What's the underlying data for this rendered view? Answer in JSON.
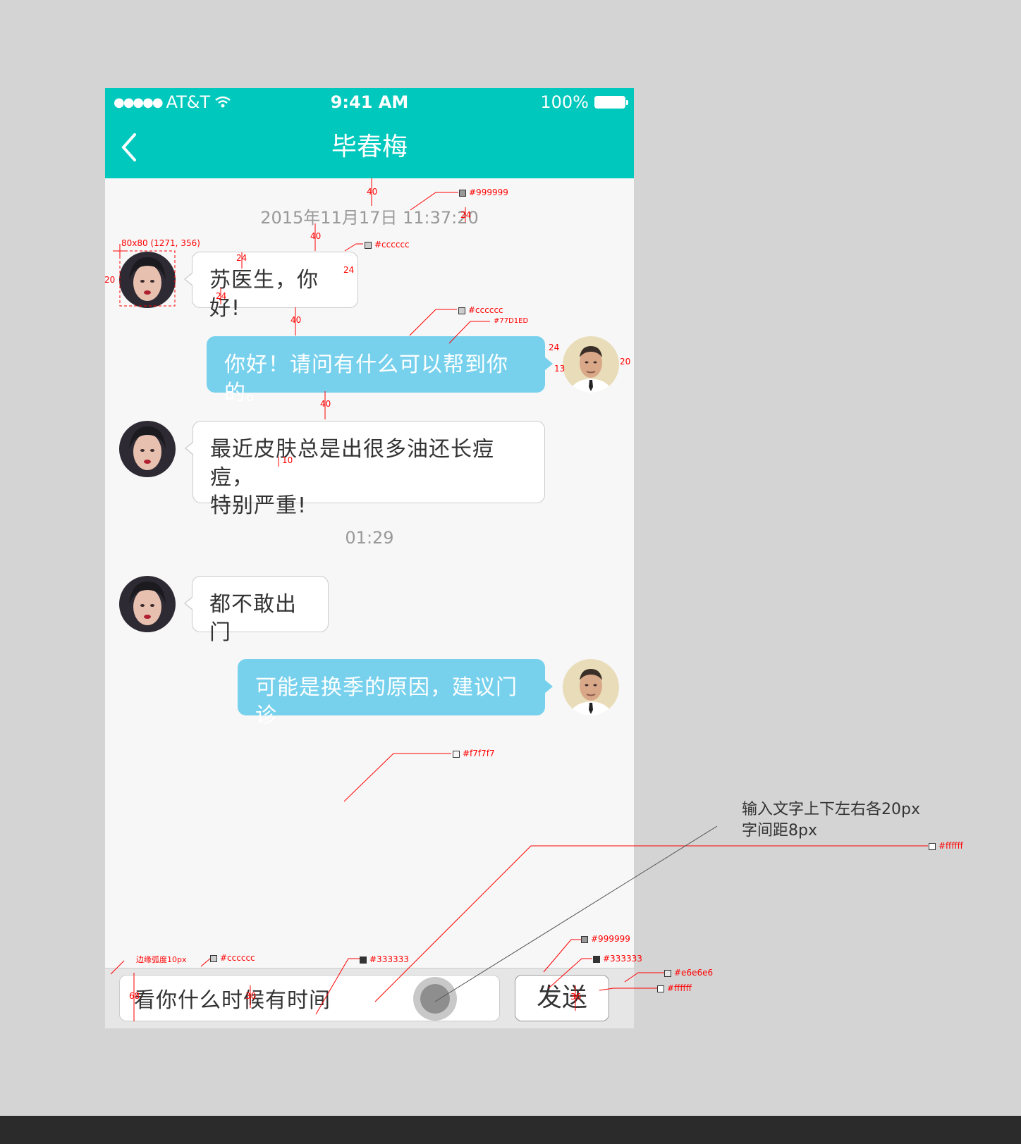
{
  "status_bar": {
    "carrier": "AT&T",
    "time": "9:41 AM",
    "battery": "100%"
  },
  "nav": {
    "title": "毕春梅"
  },
  "timestamps": [
    "2015年11月17日  11:37:20",
    "01:29"
  ],
  "messages": [
    {
      "side": "in",
      "text": "苏医生，你好!"
    },
    {
      "side": "out",
      "text": "你好！请问有什么可以帮到你的。"
    },
    {
      "side": "in",
      "text_lines": [
        "最近皮肤总是出很多油还长痘痘，",
        "特别严重!"
      ]
    },
    {
      "side": "in",
      "text": "都不敢出门"
    },
    {
      "side": "out",
      "text": "可能是换季的原因，建议门诊"
    }
  ],
  "input": {
    "value": "看你什么时候有时间",
    "send_label": "发送"
  },
  "colors": {
    "brand": "#00c8bc",
    "bubble_out": "#77D1ED",
    "background": "#f7f7f7",
    "text": "#333333",
    "muted": "#999999",
    "border": "#cccccc",
    "input_bar": "#e6e6e6"
  },
  "annotations": {
    "labels": [
      "40",
      "#999999",
      "24",
      "80x80 (1271, 356)",
      "40",
      "#cccccc",
      "24",
      "24",
      "20",
      "24",
      "40",
      "#cccccc",
      "#77D1ED",
      "24",
      "20",
      "13",
      "40",
      "10",
      "#f7f7f7",
      "#ffffff",
      "边缘弧度10px",
      "#cccccc",
      "#333333",
      "68",
      "30",
      "#999999",
      "#333333",
      "36",
      "#e6e6e6",
      "#ffffff"
    ],
    "note_lines": [
      "输入文字上下左右各20px",
      "字间距8px"
    ]
  }
}
